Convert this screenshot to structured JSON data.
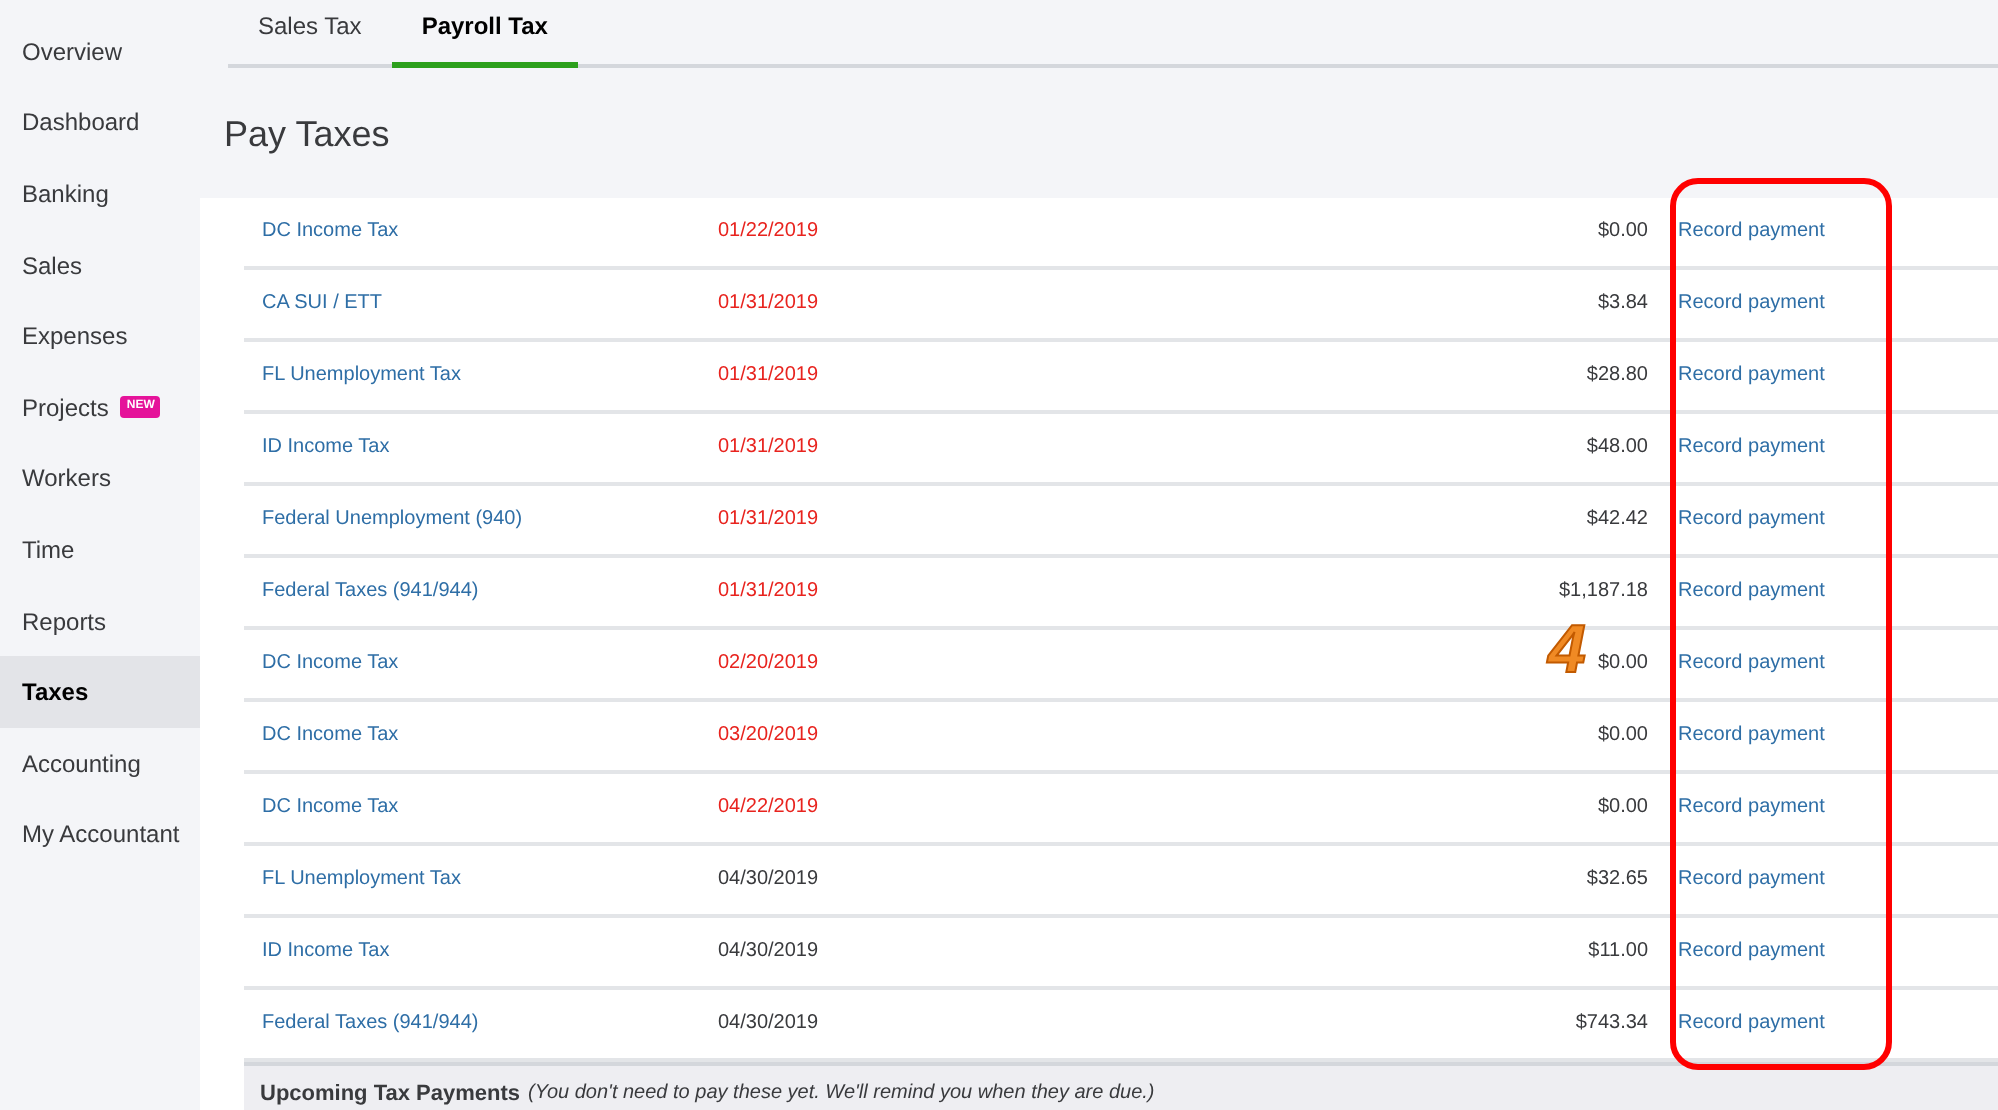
{
  "sidebar": {
    "items": [
      {
        "label": "Overview",
        "selected": false
      },
      {
        "label": "Dashboard",
        "selected": false
      },
      {
        "label": "Banking",
        "selected": false
      },
      {
        "label": "Sales",
        "selected": false
      },
      {
        "label": "Expenses",
        "selected": false
      },
      {
        "label": "Projects",
        "selected": false,
        "badge": "NEW"
      },
      {
        "label": "Workers",
        "selected": false
      },
      {
        "label": "Time",
        "selected": false
      },
      {
        "label": "Reports",
        "selected": false
      },
      {
        "label": "Taxes",
        "selected": true
      },
      {
        "label": "Accounting",
        "selected": false
      },
      {
        "label": "My Accountant",
        "selected": false
      }
    ]
  },
  "tabs": [
    {
      "label": "Sales Tax",
      "selected": false
    },
    {
      "label": "Payroll Tax",
      "selected": true
    }
  ],
  "heading": "Pay Taxes",
  "table": {
    "rows": [
      {
        "tax": "DC Income Tax",
        "due_date": "01/22/2019",
        "overdue": true,
        "amount": "$0.00",
        "action": "Record payment"
      },
      {
        "tax": "CA SUI / ETT",
        "due_date": "01/31/2019",
        "overdue": true,
        "amount": "$3.84",
        "action": "Record payment"
      },
      {
        "tax": "FL Unemployment Tax",
        "due_date": "01/31/2019",
        "overdue": true,
        "amount": "$28.80",
        "action": "Record payment"
      },
      {
        "tax": "ID Income Tax",
        "due_date": "01/31/2019",
        "overdue": true,
        "amount": "$48.00",
        "action": "Record payment"
      },
      {
        "tax": "Federal Unemployment (940)",
        "due_date": "01/31/2019",
        "overdue": true,
        "amount": "$42.42",
        "action": "Record payment"
      },
      {
        "tax": "Federal Taxes (941/944)",
        "due_date": "01/31/2019",
        "overdue": true,
        "amount": "$1,187.18",
        "action": "Record payment"
      },
      {
        "tax": "DC Income Tax",
        "due_date": "02/20/2019",
        "overdue": true,
        "amount": "$0.00",
        "action": "Record payment"
      },
      {
        "tax": "DC Income Tax",
        "due_date": "03/20/2019",
        "overdue": true,
        "amount": "$0.00",
        "action": "Record payment"
      },
      {
        "tax": "DC Income Tax",
        "due_date": "04/22/2019",
        "overdue": true,
        "amount": "$0.00",
        "action": "Record payment"
      },
      {
        "tax": "FL Unemployment Tax",
        "due_date": "04/30/2019",
        "overdue": false,
        "amount": "$32.65",
        "action": "Record payment"
      },
      {
        "tax": "ID Income Tax",
        "due_date": "04/30/2019",
        "overdue": false,
        "amount": "$11.00",
        "action": "Record payment"
      },
      {
        "tax": "Federal Taxes (941/944)",
        "due_date": "04/30/2019",
        "overdue": false,
        "amount": "$743.34",
        "action": "Record payment"
      }
    ]
  },
  "upcoming": {
    "title": "Upcoming Tax Payments",
    "note": "(You don't need to pay these yet. We'll remind you when they are due.)"
  },
  "annotation": {
    "number": "4"
  }
}
